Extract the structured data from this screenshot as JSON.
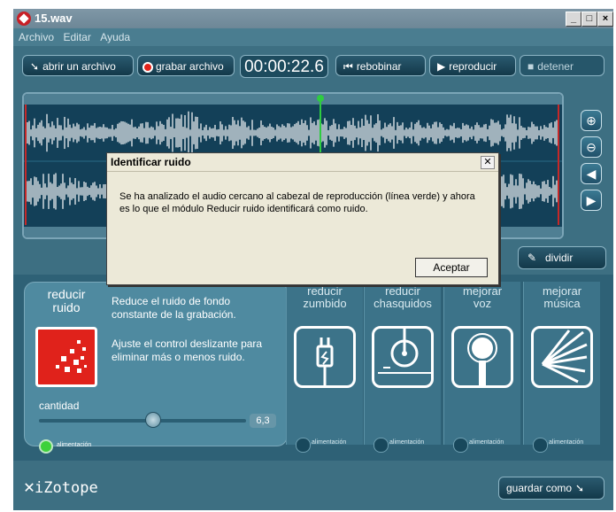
{
  "window": {
    "title": "15.wav"
  },
  "menu": [
    "Archivo",
    "Editar",
    "Ayuda"
  ],
  "toolbar": {
    "open_label": "abrir un archivo",
    "record_label": "grabar archivo",
    "time": "00:00:22.6",
    "rewind_label": "rebobinar",
    "play_label": "reproducir",
    "stop_label": "detener"
  },
  "dialog": {
    "title": "Identificar ruido",
    "message": "Se ha analizado el audio cercano al cabezal de reproducción (línea verde) y ahora es lo que el módulo Reducir ruido identificará como ruido.",
    "ok_label": "Aceptar"
  },
  "split_label": "dividir",
  "modules": {
    "main": {
      "title_line1": "reducir",
      "title_line2": "ruido",
      "desc1": "Reduce el ruido de fondo constante de la grabación.",
      "desc2": "Ajuste el control deslizante para eliminar más o menos ruido.",
      "amount_label": "cantidad",
      "amount_value": "6,3",
      "amount_fraction": 0.55,
      "power_label": "alimentación",
      "power_on": true
    },
    "others": [
      {
        "line1": "reducir",
        "line2": "zumbido",
        "power_label": "alimentación",
        "icon": "plug-icon"
      },
      {
        "line1": "reducir",
        "line2": "chasquidos",
        "power_label": "alimentación",
        "icon": "vinyl-icon"
      },
      {
        "line1": "mejorar",
        "line2": "voz",
        "power_label": "alimentación",
        "icon": "microphone-icon"
      },
      {
        "line1": "mejorar",
        "line2": "música",
        "power_label": "alimentación",
        "icon": "burst-icon"
      }
    ]
  },
  "logo_text": "iZotope",
  "save_as_label": "guardar como",
  "colors": {
    "accent": "#e2231a",
    "playhead": "#2ecc40",
    "background": "#3d6f82"
  }
}
